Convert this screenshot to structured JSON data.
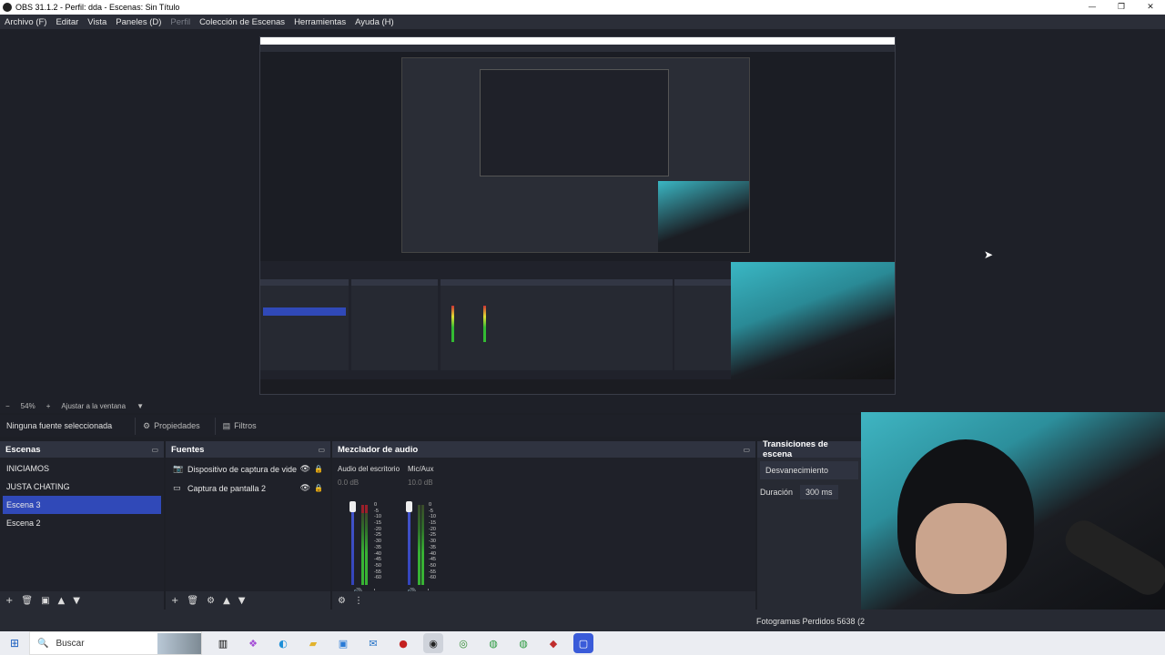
{
  "window": {
    "title": "OBS 31.1.2 - Perfil: dda - Escenas: Sin Título"
  },
  "menu": [
    "Archivo (F)",
    "Editar",
    "Vista",
    "Paneles (D)",
    "Perfil",
    "Colección de Escenas",
    "Herramientas",
    "Ayuda (H)"
  ],
  "scale": {
    "zoom": "54%",
    "fit": "Ajustar a la ventana"
  },
  "properties_bar": {
    "no_source": "Ninguna fuente seleccionada",
    "properties": "Propiedades",
    "filters": "Filtros"
  },
  "scenes": {
    "title": "Escenas",
    "items": [
      "INICIAMOS",
      "JUSTA CHATING",
      "Escena 3",
      "Escena 2"
    ],
    "active": "Escena 3"
  },
  "sources": {
    "title": "Fuentes",
    "items": [
      "Dispositivo de captura de video",
      "Captura de pantalla 2"
    ]
  },
  "mixer": {
    "title": "Mezclador de audio",
    "channels": [
      {
        "name": "Audio del escritorio",
        "db": "0.0 dB"
      },
      {
        "name": "Mic/Aux",
        "db": "10.0 dB"
      }
    ],
    "ticks": [
      "0",
      "-5",
      "-10",
      "-15",
      "-20",
      "-25",
      "-30",
      "-35",
      "-40",
      "-45",
      "-50",
      "-55",
      "-60"
    ]
  },
  "transitions": {
    "title": "Transiciones de escena",
    "type": "Desvanecimiento",
    "duration_label": "Duración",
    "duration": "300 ms"
  },
  "status": {
    "frames": "Fotogramas Perdidos 5638 (2"
  },
  "taskbar": {
    "search": "Buscar"
  },
  "colors": {
    "accent": "#3049b8",
    "bg": "#1d1f26",
    "dock": "#272a33"
  }
}
